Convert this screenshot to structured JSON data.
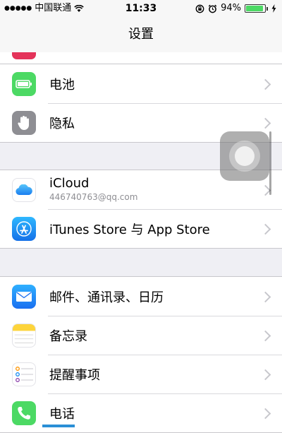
{
  "status_bar": {
    "signal": "●●●●●",
    "carrier": "中国联通",
    "wifi_icon": "wifi-icon",
    "time": "11:33",
    "battery_percent": "94%",
    "battery_level": 0.94
  },
  "nav": {
    "title": "设置"
  },
  "groups": [
    {
      "rows": [
        {
          "label": "电池",
          "icon": "battery-icon",
          "color": "#4cd964"
        },
        {
          "label": "隐私",
          "icon": "hand-icon",
          "color": "#8e8e93"
        }
      ]
    },
    {
      "rows": [
        {
          "label": "iCloud",
          "sublabel": "446740763@qq.com",
          "icon": "icloud-icon",
          "color": "#ffffff"
        },
        {
          "label": "iTunes Store 与 App Store",
          "icon": "app-store-icon",
          "color": "#1a8cf0"
        }
      ]
    },
    {
      "rows": [
        {
          "label": "邮件、通讯录、日历",
          "icon": "mail-icon",
          "color": "#1e7ff0"
        },
        {
          "label": "备忘录",
          "icon": "notes-icon",
          "color": "#fdd43b"
        },
        {
          "label": "提醒事项",
          "icon": "reminders-icon",
          "color": "#ffffff"
        },
        {
          "label": "电话",
          "icon": "phone-icon",
          "color": "#4cd964"
        }
      ]
    }
  ]
}
